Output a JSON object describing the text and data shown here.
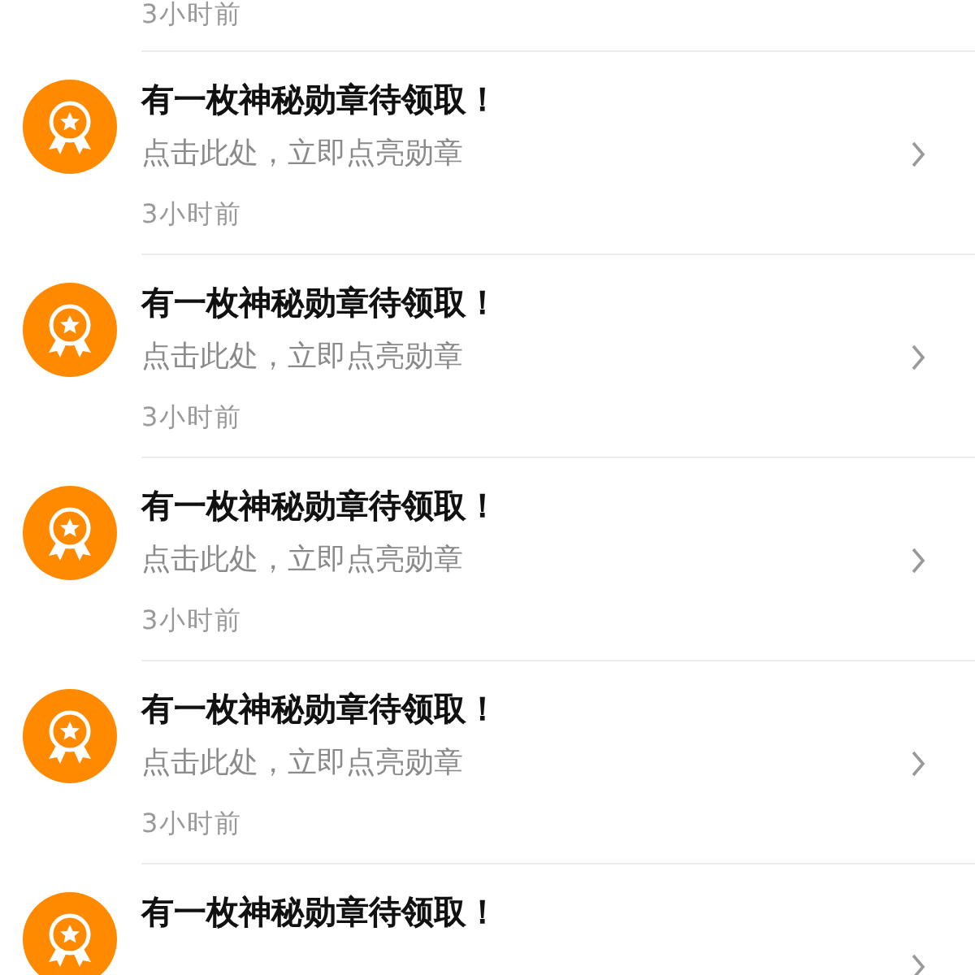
{
  "top_partial_item": {
    "time": "3小时前"
  },
  "notifications": [
    {
      "title": "有一枚神秘勋章待领取！",
      "subtitle": "点击此处，立即点亮勋章",
      "time": "3小时前"
    },
    {
      "title": "有一枚神秘勋章待领取！",
      "subtitle": "点击此处，立即点亮勋章",
      "time": "3小时前"
    },
    {
      "title": "有一枚神秘勋章待领取！",
      "subtitle": "点击此处，立即点亮勋章",
      "time": "3小时前"
    },
    {
      "title": "有一枚神秘勋章待领取！",
      "subtitle": "点击此处，立即点亮勋章",
      "time": "3小时前"
    },
    {
      "title": "有一枚神秘勋章待领取！"
    }
  ]
}
